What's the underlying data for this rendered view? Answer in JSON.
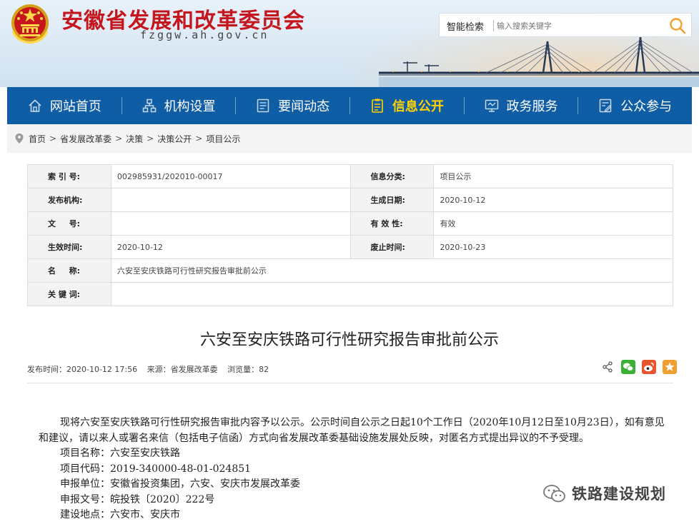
{
  "header": {
    "site_title": "安徽省发展和改革委员会",
    "site_domain": "fzggw.ah.gov.cn",
    "search_label": "智能检索",
    "search_placeholder": "输入搜索关键字"
  },
  "nav": {
    "items": [
      {
        "label": "网站首页",
        "icon": "home-icon"
      },
      {
        "label": "机构设置",
        "icon": "org-chart-icon"
      },
      {
        "label": "要闻动态",
        "icon": "news-icon"
      },
      {
        "label": "信息公开",
        "icon": "document-icon",
        "active": true
      },
      {
        "label": "政务服务",
        "icon": "monitor-icon"
      },
      {
        "label": "公众参与",
        "icon": "feedback-icon"
      }
    ]
  },
  "breadcrumb": [
    "首页",
    "省发展改革委",
    "决策",
    "决策公开",
    "项目公示"
  ],
  "info": {
    "rows": [
      {
        "l1": "索 引 号:",
        "v1": "002985931/202010-00017",
        "l2": "信息分类:",
        "v2": "项目公示"
      },
      {
        "l1": "发布机构:",
        "v1": "",
        "l2": "生成日期:",
        "v2": "2020-10-12"
      },
      {
        "l1": "文 　 号:",
        "v1": "",
        "l2": "有 效 性:",
        "v2": "有效"
      },
      {
        "l1": "生效时间:",
        "v1": "2020-10-12",
        "l2": "废止时间:",
        "v2": "2020-10-23"
      }
    ],
    "name_label": "名 　 称:",
    "name_value": "六安至安庆铁路可行性研究报告审批前公示",
    "keywords_label": "关 键 词:",
    "keywords_value": ""
  },
  "article": {
    "title": "六安至安庆铁路可行性研究报告审批前公示",
    "publish_time": "发布时间：2020-10-12 17:56",
    "source": "来源：省发展改革委",
    "views": "浏览量：82",
    "paragraph": "现将六安至安庆铁路可行性研究报告审批内容予以公示。公示时间自公示之日起10个工作日（2020年10月12日至10月23日），如有意见和建议，请以来人或署名来信（包括电子信函）方式向省发展改革委基础设施发展处反映，对匿名方式提出异议的不予受理。",
    "items": [
      "项目名称：六安至安庆铁路",
      "项目代码：2019-340000-48-01-024851",
      "申报单位：安徽省投资集团，六安、安庆市发展改革委",
      "申报文号：皖投铁〔2020〕222号",
      "建设地点：六安市、安庆市"
    ]
  },
  "share": {
    "buttons": [
      {
        "icon": "share-icon",
        "color": "#555555"
      },
      {
        "icon": "wechat-icon",
        "color": "#3cb034"
      },
      {
        "icon": "weibo-icon",
        "color": "#e8542c"
      },
      {
        "icon": "favorite-icon",
        "color": "#f0a030"
      }
    ]
  },
  "watermark": {
    "text": "铁路建设规划"
  },
  "colors": {
    "brand_red": "#c4161c",
    "nav_blue": "#0f5da4",
    "nav_active": "#ffd200"
  }
}
